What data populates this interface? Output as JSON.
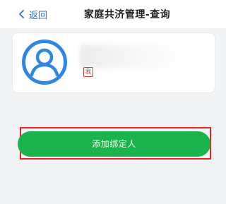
{
  "header": {
    "back_label": "返回",
    "title": "家庭共济管理-查询"
  },
  "member_card": {
    "badge": "我",
    "avatar_icon": "user-avatar-icon"
  },
  "actions": {
    "add_label": "添加绑定人"
  },
  "colors": {
    "accent_blue": "#2f6fd6",
    "button_green": "#1bb34b",
    "highlight_red": "#e0262b",
    "badge_red": "#d23a3a",
    "avatar_blue": "#2f86e6"
  }
}
